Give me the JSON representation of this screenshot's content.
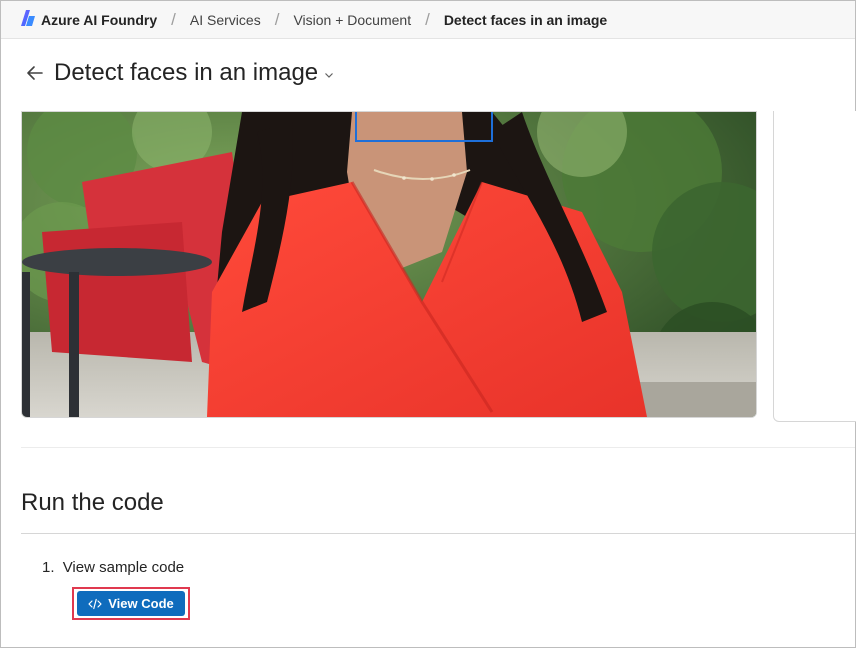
{
  "breadcrumb": {
    "brand": "Azure AI Foundry",
    "items": [
      "AI Services",
      "Vision + Document"
    ],
    "current": "Detect faces in an image",
    "separator": "/"
  },
  "page": {
    "title": "Detect faces in an image"
  },
  "run_section": {
    "title": "Run the code",
    "step_number": "1.",
    "step_label": "View sample code",
    "button_label": "View Code"
  },
  "colors": {
    "accent": "#0f6cbd",
    "highlight": "#e0394f",
    "face_box": "#1e6fd9"
  },
  "icons": {
    "brand": "foundry-logo-icon",
    "back": "back-arrow-icon",
    "chevron": "chevron-down-icon",
    "code": "code-icon"
  }
}
